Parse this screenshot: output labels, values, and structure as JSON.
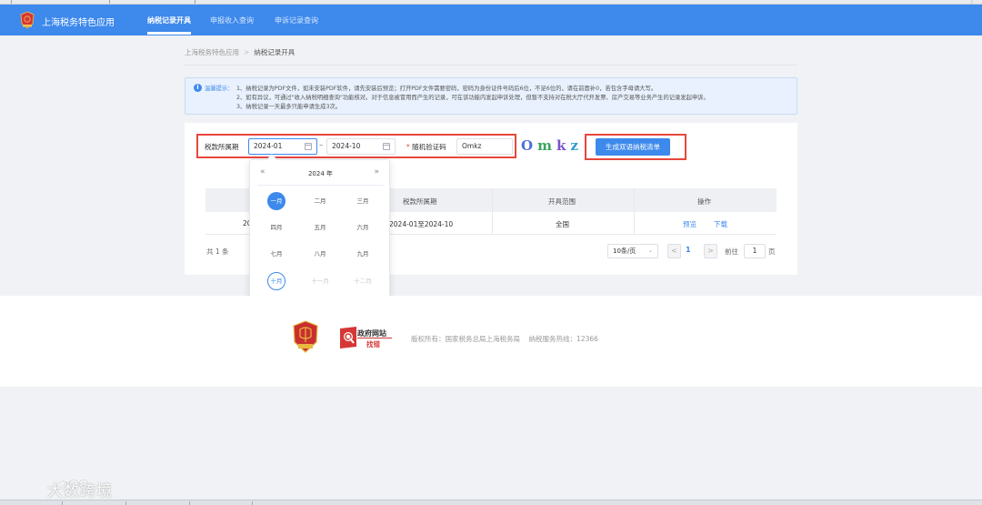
{
  "navbar": {
    "brand": "上海税务特色应用",
    "items": [
      "纳税记录开具",
      "申报收入查询",
      "申诉记录查询"
    ],
    "active_index": 0,
    "color": "#3d89ec"
  },
  "breadcrumb": {
    "root": "上海税务特色应用",
    "separator": ">",
    "current": "纳税记录开具"
  },
  "notice": {
    "icon": "info-icon",
    "title": "温馨提示：",
    "lines": [
      "1、纳税记录为PDF文件，如未安装PDF软件，请先安装后预览；打开PDF文件需要密码，密码为身份证件号码后6位，不足6位的，请在前面补0，若包含字母请大写。",
      "2、如有异议，可通过\"收入纳税明细查询\"功能核对。对于信息被冒用而产生的记录，可在该功能内发起申诉处理，但暂不支持对在税大厅代开发票、房产交易等业务产生的记录发起申诉。",
      "3、纳税记录一天最多只能申请生成3次。"
    ]
  },
  "form": {
    "period_label": "税款所属期",
    "start_date": "2024-01",
    "range_separator": "–",
    "end_date": "2024-10",
    "captcha_required_mark": "*",
    "captcha_label": "随机验证码",
    "captcha_value": "Omkz",
    "captcha_image_chars": [
      "O",
      "m",
      "k",
      "z"
    ],
    "submit_label": "生成双语纳税清单",
    "highlight_color": "#e8473c"
  },
  "table": {
    "columns": [
      "",
      "税款所属期",
      "开具范围",
      "操作"
    ],
    "rows": [
      {
        "partial": "20",
        "period": "2024-01至2024-10",
        "scope": "全国",
        "preview": "预览",
        "download": "下载"
      }
    ]
  },
  "pagination": {
    "total": "共 1 条",
    "page_size": "10条/页",
    "prev": "<",
    "current_page": "1",
    "next": ">",
    "goto_label": "前往",
    "goto_value": "1",
    "page_suffix": "页"
  },
  "picker": {
    "prev": "«",
    "next": "»",
    "year": "2024 年",
    "months": [
      {
        "label": "一月",
        "state": "selected"
      },
      {
        "label": "二月",
        "state": "normal"
      },
      {
        "label": "三月",
        "state": "normal"
      },
      {
        "label": "四月",
        "state": "normal"
      },
      {
        "label": "五月",
        "state": "normal"
      },
      {
        "label": "六月",
        "state": "normal"
      },
      {
        "label": "七月",
        "state": "normal"
      },
      {
        "label": "八月",
        "state": "normal"
      },
      {
        "label": "九月",
        "state": "normal"
      },
      {
        "label": "十月",
        "state": "current"
      },
      {
        "label": "十一月",
        "state": "disabled"
      },
      {
        "label": "十二月",
        "state": "disabled"
      }
    ]
  },
  "footer": {
    "gov_site_line1": "政府网站",
    "gov_site_line2": "找错",
    "copyright": "版权所有：国家税务总局上海税务局",
    "hotline": "纳税服务热线：12366"
  },
  "watermark": {
    "text": "大数跨境"
  }
}
